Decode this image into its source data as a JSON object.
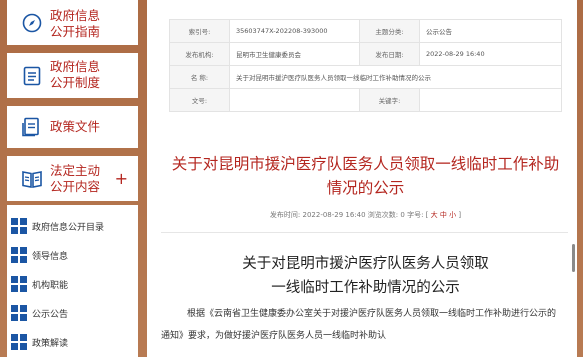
{
  "sidebar": {
    "cards": [
      {
        "label": "政府信息\n公开指南",
        "icon": "compass-icon"
      },
      {
        "label": "政府信息\n公开制度",
        "icon": "document-list-icon"
      },
      {
        "label": "政策文件",
        "icon": "policy-file-icon"
      },
      {
        "label": "法定主动\n公开内容",
        "icon": "open-book-icon",
        "expand": "+"
      }
    ],
    "subitems": [
      {
        "label": "政府信息公开目录"
      },
      {
        "label": "领导信息"
      },
      {
        "label": "机构职能"
      },
      {
        "label": "公示公告"
      },
      {
        "label": "政策解读"
      }
    ]
  },
  "info_table": {
    "index_label": "索引号:",
    "index_value": "35603747X-202208-393000",
    "topic_label": "主题分类:",
    "topic_value": "公示公告",
    "issuer_label": "发布机构:",
    "issuer_value": "昆明市卫生健康委员会",
    "date_label": "发布日期:",
    "date_value": "2022-08-29 16:40",
    "name_label": "名 称:",
    "name_value": "关于对昆明市援沪医疗队医务人员领取一线临时工作补助情况的公示",
    "docno_label": "文号:",
    "docno_value": "",
    "keyword_label": "关键字:",
    "keyword_value": ""
  },
  "article": {
    "title": "关于对昆明市援沪医疗队医务人员领取一线临时工作补助情况的公示",
    "meta_prefix": "发布时间: 2022-08-29 16:40 浏览次数: 0 字号: [",
    "size_large": "大",
    "size_medium": "中",
    "size_small": "小",
    "meta_suffix": "]",
    "doc_title_line1": "关于对昆明市援沪医疗队医务人员领取",
    "doc_title_line2": "一线临时工作补助情况的公示",
    "body": "根据《云南省卫生健康委办公室关于对援沪医疗队医务人员领取一线临时工作补助进行公示的通知》要求，为做好援沪医疗队医务人员一线临时补助认"
  },
  "colors": {
    "accent": "#b4261f",
    "icon_blue": "#1b56a4",
    "background": "#b77a52"
  }
}
